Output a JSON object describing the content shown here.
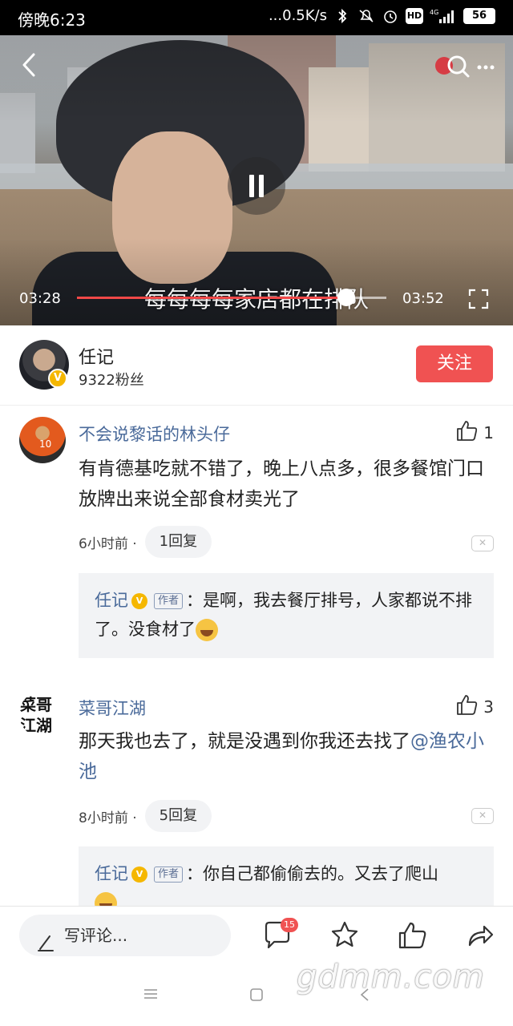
{
  "status_bar": {
    "time": "傍晚6:23",
    "network_speed": "...0.5K/s",
    "hd_label": "HD",
    "signal_label": "4G",
    "battery": "56"
  },
  "video": {
    "subtitle": "每每每每家店都在排队",
    "current_time": "03:28",
    "duration": "03:52",
    "progress_fraction": 0.87
  },
  "author": {
    "name": "任记",
    "fans": "9322粉丝",
    "follow_label": "关注",
    "verified_label": "V"
  },
  "comments": [
    {
      "user": "不会说黎话的林头仔",
      "likes": "1",
      "text": "有肯德基吃就不错了，晚上八点多，很多餐馆门口放牌出来说全部食材卖光了",
      "time": "6小时前 ·",
      "replies_label": "1回复",
      "reply": {
        "name": "任记",
        "tag": "作者",
        "text": "：是啊，我去餐厅排号，人家都说不排了。没食材了"
      }
    },
    {
      "user": "菜哥江湖",
      "avatar_text": "菜哥\n江湖",
      "likes": "3",
      "text_before": "那天我也去了，就是没遇到你我还去找了",
      "mention": "@渔农小池",
      "time": "8小时前 ·",
      "replies_label": "5回复",
      "reply": {
        "name": "任记",
        "tag": "作者",
        "text": "：你自己都偷偷去的。又去了爬山"
      }
    }
  ],
  "bottom_bar": {
    "input_placeholder": "写评论...",
    "comment_count_badge": "15"
  },
  "watermark": "gdmm.com",
  "colors": {
    "accent_red": "#f05252",
    "link_blue": "#4a6a9a",
    "verified_gold": "#f5b700"
  }
}
